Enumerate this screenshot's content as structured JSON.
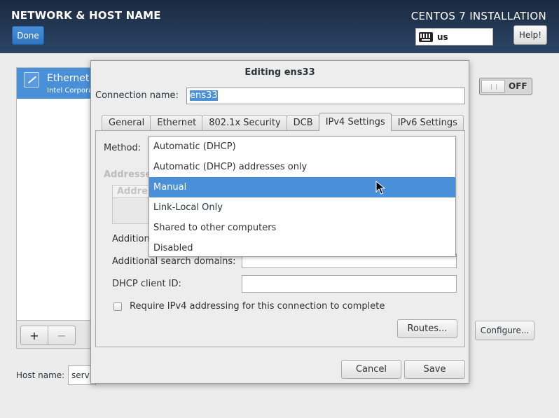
{
  "header": {
    "title": "NETWORK & HOST NAME",
    "done_label": "Done",
    "install_title": "CENTOS 7 INSTALLATION",
    "keyboard_layout": "us",
    "help_label": "Help!"
  },
  "devices": {
    "items": [
      {
        "name": "Ethernet",
        "subtitle": "Intel Corpora",
        "icon": "ethernet-icon"
      }
    ],
    "add_label": "+",
    "remove_label": "−"
  },
  "hostname": {
    "label": "Host name:",
    "value": "serv"
  },
  "toggle": {
    "label": "OFF"
  },
  "configure_label": "Configure...",
  "dialog": {
    "title": "Editing ens33",
    "connection_name_label": "Connection name:",
    "connection_name_value": "ens33",
    "tabs": [
      "General",
      "Ethernet",
      "802.1x Security",
      "DCB",
      "IPv4 Settings",
      "IPv6 Settings"
    ],
    "active_tab": "IPv4 Settings",
    "method_label": "Method:",
    "addresses_header": "Addresse",
    "addresses_col_header": "Addre",
    "additional_dns_label": "Addition",
    "search_domains_label": "Additional search domains:",
    "dhcp_client_id_label": "DHCP client ID:",
    "require_ipv4_label": "Require IPv4 addressing for this connection to complete",
    "routes_label": "Routes...",
    "cancel_label": "Cancel",
    "save_label": "Save"
  },
  "method_dropdown": {
    "options": [
      "Automatic (DHCP)",
      "Automatic (DHCP) addresses only",
      "Manual",
      "Link-Local Only",
      "Shared to other computers",
      "Disabled"
    ],
    "highlighted": "Manual"
  },
  "colors": {
    "accent": "#4a90d9",
    "header_bg": "#1b2a3f"
  }
}
